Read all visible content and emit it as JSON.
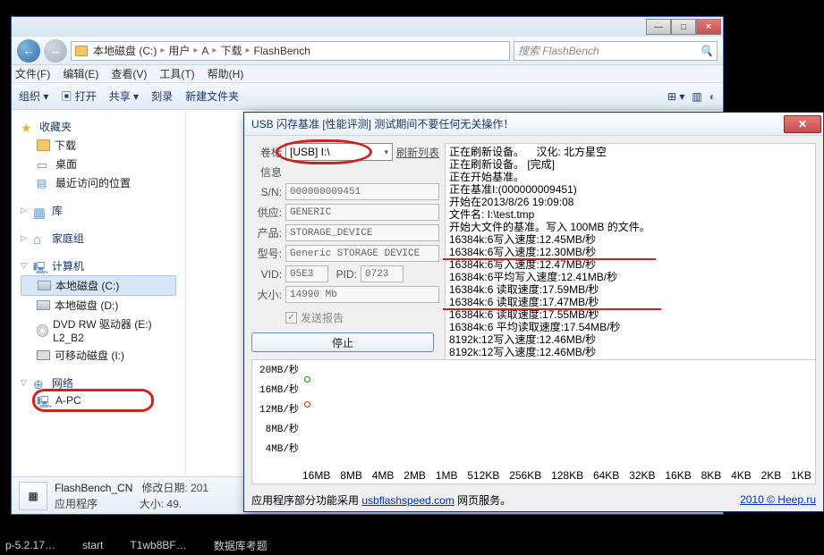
{
  "explorer": {
    "titlebuttons": {
      "min": "—",
      "max": "□",
      "close": "✕"
    },
    "breadcrumb": [
      "本地磁盘 (C:)",
      "用户",
      "A",
      "下载",
      "FlashBench"
    ],
    "search_placeholder": "搜索 FlashBench",
    "menu": [
      "文件(F)",
      "编辑(E)",
      "查看(V)",
      "工具(T)",
      "帮助(H)"
    ],
    "toolbar": [
      "组织 ▾",
      "▣ 打开",
      "共享 ▾",
      "刻录",
      "新建文件夹"
    ],
    "sidebar": {
      "fav": {
        "head": "收藏夹",
        "items": [
          "下载",
          "桌面",
          "最近访问的位置"
        ]
      },
      "lib": {
        "head": "库"
      },
      "home": {
        "head": "家庭组"
      },
      "pc": {
        "head": "计算机",
        "items": [
          "本地磁盘 (C:)",
          "本地磁盘 (D:)",
          "DVD RW 驱动器 (E:) L2_B2",
          "可移动磁盘 (I:)"
        ]
      },
      "net": {
        "head": "网络",
        "items": [
          "A-PC"
        ]
      }
    },
    "detail": {
      "name": "FlashBench_CN",
      "type": "应用程序",
      "date_lbl": "修改日期:",
      "date": "201",
      "size_lbl": "大小:",
      "size": "49."
    }
  },
  "dialog": {
    "title": "USB 闪存基准 [性能评测] 测试期间不要任何无关操作！",
    "volume_lbl": "卷标",
    "volume_value": "[USB] I:\\",
    "refresh": "刷新列表",
    "info_lbl": "信息",
    "rows": {
      "sn": {
        "lbl": "S/N:",
        "val": "000000009451"
      },
      "vendor": {
        "lbl": "供应:",
        "val": "GENERIC"
      },
      "product": {
        "lbl": "产品:",
        "val": "STORAGE_DEVICE"
      },
      "model": {
        "lbl": "型号:",
        "val": "Generic STORAGE DEVICE"
      },
      "vid": {
        "lbl": "VID:",
        "val": "05E3"
      },
      "pid": {
        "lbl": "PID:",
        "val": "0723"
      },
      "size": {
        "lbl": "大小:",
        "val": "14990 Mb"
      }
    },
    "chk_label": "发送报告",
    "stop": "停止",
    "log": [
      "正在刷新设备。    汉化: 北方星空",
      "正在刷新设备。 [完成]",
      "正在开始基准。",
      "正在基准I:(000000009451)",
      "开始在2013/8/26 19:09:08",
      "文件名: I:\\test.tmp",
      "开始大文件的基准。写入 100MB 的文件。",
      "16384k:6写入速度:12.45MB/秒",
      "16384k:6写入速度:12.30MB/秒",
      "16384k:6写入速度:12.47MB/秒",
      "16384k:6平均写入速度:12.41MB/秒",
      "16384k:6 读取速度:17.59MB/秒",
      "16384k:6 读取速度:17.47MB/秒",
      "16384k:6 读取速度:17.55MB/秒",
      "16384k:6 平均读取速度:17.54MB/秒",
      "8192k:12写入速度:12.46MB/秒",
      "8192k:12写入速度:12.46MB/秒"
    ],
    "footer_prefix": "应用程序部分功能采用 ",
    "footer_link": "usbflashspeed.com",
    "footer_suffix": " 网页服务。",
    "footer_right": "2010 © Heep.ru"
  },
  "taskbar": [
    "p-5.2.17…",
    "start",
    "T1wb8BF…",
    "数据库考题"
  ],
  "chart_data": {
    "type": "scatter",
    "x_labels": [
      "16MB",
      "8MB",
      "4MB",
      "2MB",
      "1MB",
      "512KB",
      "256KB",
      "128KB",
      "64KB",
      "32KB",
      "16KB",
      "8KB",
      "4KB",
      "2KB",
      "1KB"
    ],
    "y_ticks": [
      "20MB/秒",
      "16MB/秒",
      "12MB/秒",
      "8MB/秒",
      "4MB/秒"
    ],
    "ylim": [
      0,
      22
    ],
    "series": [
      {
        "name": "read",
        "color": "#0a8a0a",
        "points": [
          {
            "x": "16MB",
            "y": 17.54
          }
        ]
      },
      {
        "name": "write",
        "color": "#c02020",
        "points": [
          {
            "x": "16MB",
            "y": 12.41
          }
        ]
      }
    ]
  }
}
